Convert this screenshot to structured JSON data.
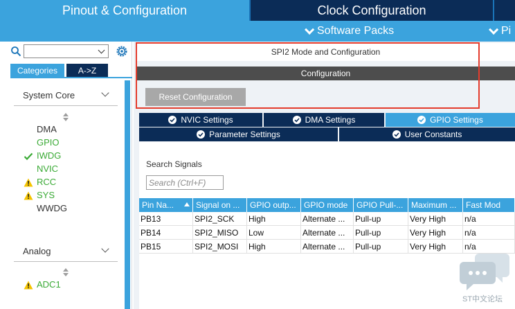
{
  "top_tabs": {
    "pinout": "Pinout & Configuration",
    "clock": "Clock Configuration"
  },
  "menu": {
    "software_packs": "Software Packs",
    "pinout": "Pi"
  },
  "left": {
    "search_value": "",
    "categories_tab": "Categories",
    "az_tab": "A->Z",
    "system_core": {
      "title": "System Core",
      "items": [
        {
          "label": "DMA",
          "state": "plain",
          "icon": ""
        },
        {
          "label": "GPIO",
          "state": "green",
          "icon": ""
        },
        {
          "label": "IWDG",
          "state": "green",
          "icon": "check-icon"
        },
        {
          "label": "NVIC",
          "state": "green",
          "icon": ""
        },
        {
          "label": "RCC",
          "state": "green",
          "icon": "warning-icon"
        },
        {
          "label": "SYS",
          "state": "green",
          "icon": "warning-icon"
        },
        {
          "label": "WWDG",
          "state": "plain",
          "icon": ""
        }
      ]
    },
    "analog": {
      "title": "Analog",
      "items": [
        {
          "label": "ADC1",
          "state": "green",
          "icon": "warning-icon"
        }
      ]
    }
  },
  "main": {
    "mode_title": "SPI2 Mode and Configuration",
    "configuration_label": "Configuration",
    "reset_button": "Reset Configuration",
    "tabs_row1": [
      "NVIC Settings",
      "DMA Settings",
      "GPIO Settings"
    ],
    "tabs_row2": [
      "Parameter Settings",
      "User Constants"
    ],
    "active_tab": "GPIO Settings",
    "search_label": "Search Signals",
    "search_placeholder": "Search (Ctrl+F)",
    "columns": [
      "Pin Na...",
      "Signal on ...",
      "GPIO outp...",
      "GPIO mode",
      "GPIO Pull-...",
      "Maximum ...",
      "Fast Mod"
    ],
    "rows": [
      [
        "PB13",
        "SPI2_SCK",
        "High",
        "Alternate ...",
        "Pull-up",
        "Very High",
        "n/a"
      ],
      [
        "PB14",
        "SPI2_MISO",
        "Low",
        "Alternate ...",
        "Pull-up",
        "Very High",
        "n/a"
      ],
      [
        "PB15",
        "SPI2_MOSI",
        "High",
        "Alternate ...",
        "Pull-up",
        "Very High",
        "n/a"
      ]
    ]
  },
  "watermark": "ST中文论坛",
  "colors": {
    "accent": "#3ba3dd",
    "dark_navy": "#0b2c57",
    "green": "#3aaa35",
    "warning": "#f5c400",
    "highlight": "#e43b2c"
  }
}
